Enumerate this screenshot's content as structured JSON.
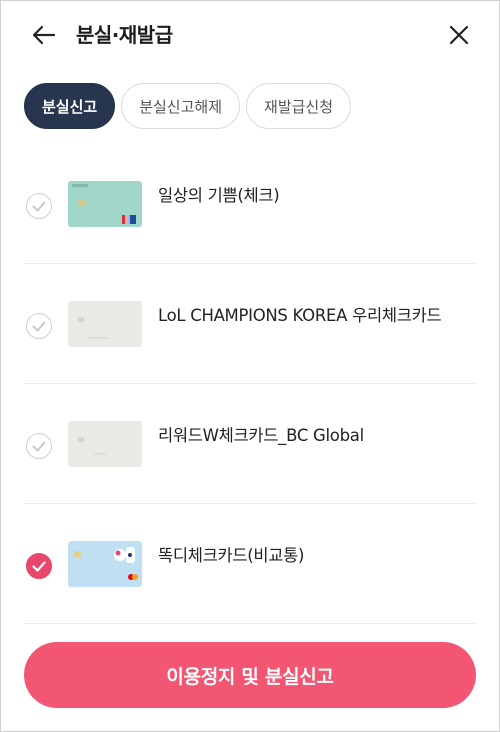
{
  "header": {
    "title": "분실·재발급",
    "back_icon": "arrow-left-icon",
    "close_icon": "close-icon"
  },
  "tabs": [
    {
      "label": "분실신고",
      "active": true
    },
    {
      "label": "분실신고해제",
      "active": false
    },
    {
      "label": "재발급신청",
      "active": false
    }
  ],
  "cards": [
    {
      "name": "일상의 기쁨(체크)",
      "checked": false,
      "card_color": "#9fd6c8"
    },
    {
      "name": "LoL CHAMPIONS KOREA 우리체크카드",
      "checked": false,
      "card_color": "#e9e9e6"
    },
    {
      "name": "리워드W체크카드_BC Global",
      "checked": false,
      "card_color": "#e9e9e6"
    },
    {
      "name": "똑디체크카드(비교통)",
      "checked": true,
      "card_color": "#bfe0f3"
    }
  ],
  "cta": {
    "label": "이용정지 및 분실신고"
  },
  "colors": {
    "accent": "#f25673",
    "tab_active": "#27354f",
    "check_active": "#e8466a"
  }
}
